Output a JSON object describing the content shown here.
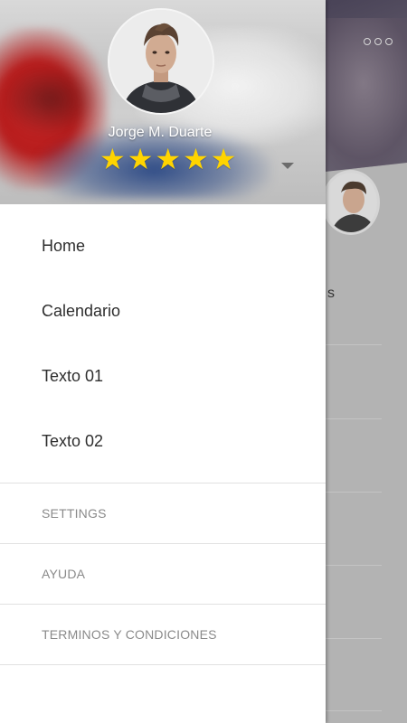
{
  "drawer": {
    "profile": {
      "name": "Jorge M. Duarte",
      "rating": 5,
      "rating_max": 5,
      "star_glyph": "★",
      "star_color": "#ffd400",
      "avatar_icon": "user-photo"
    },
    "nav_items": [
      {
        "label": "Home"
      },
      {
        "label": "Calendario"
      },
      {
        "label": "Texto 01"
      },
      {
        "label": "Texto 02"
      }
    ],
    "secondary_items": [
      {
        "label": "SETTINGS"
      },
      {
        "label": "AYUDA"
      },
      {
        "label": "TERMINOS Y CONDICIONES"
      }
    ]
  },
  "background": {
    "partial_text": "s",
    "more_icon": "more-horizontal-icon"
  },
  "colors": {
    "primary_text": "#2e2e2e",
    "secondary_text": "#8a8a8a",
    "divider": "#e1e1e1"
  }
}
